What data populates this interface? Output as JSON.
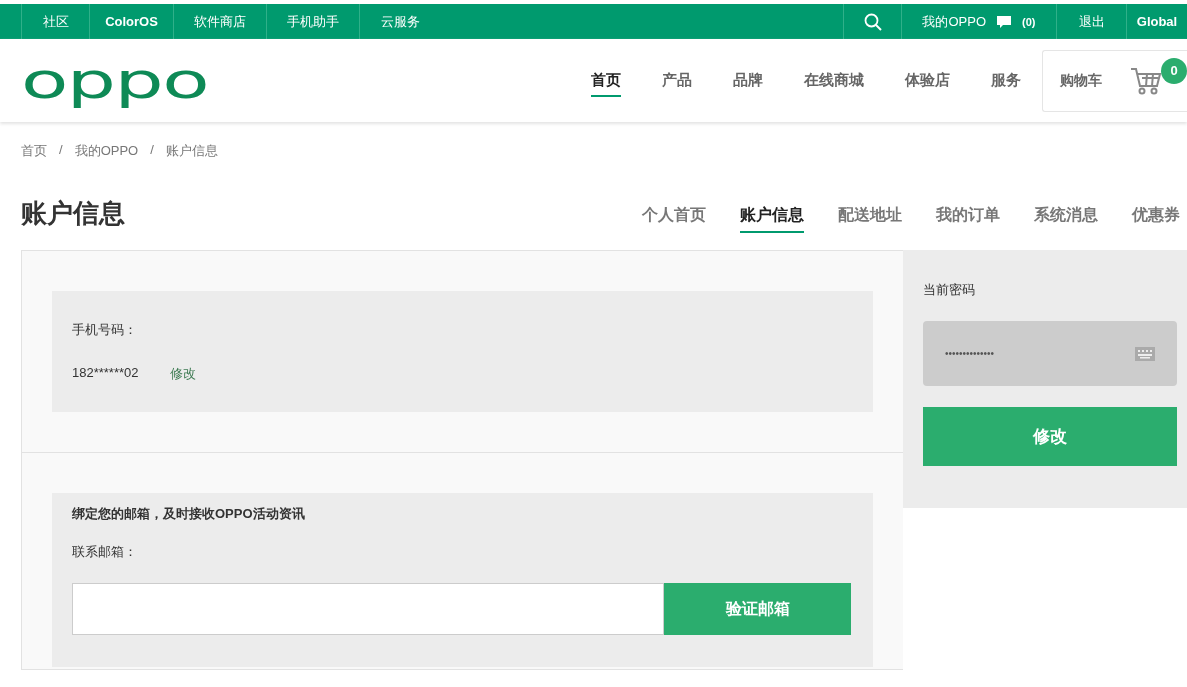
{
  "top_bar": {
    "links": [
      "社区",
      "ColorOS",
      "软件商店",
      "手机助手",
      "云服务"
    ],
    "account": "我的OPPO",
    "messages": "(0)",
    "right_links": [
      "退出",
      "Global"
    ]
  },
  "header": {
    "logo": "oppo",
    "nav": [
      {
        "label": "首页",
        "selected": true
      },
      {
        "label": "产品",
        "selected": false
      },
      {
        "label": "品牌",
        "selected": false
      },
      {
        "label": "在线商城",
        "selected": false
      },
      {
        "label": "体验店",
        "selected": false
      },
      {
        "label": "服务",
        "selected": false
      }
    ],
    "cart": {
      "label": "购物车",
      "count": "0"
    }
  },
  "breadcrumb": {
    "separator": "/",
    "items": [
      "首页",
      "我的OPPO",
      "账户信息"
    ]
  },
  "page_title": "账户信息",
  "account_tabs": [
    {
      "label": "个人首页",
      "selected": false
    },
    {
      "label": "账户信息",
      "selected": true
    },
    {
      "label": "配送地址",
      "selected": false
    },
    {
      "label": "我的订单",
      "selected": false
    },
    {
      "label": "系统消息",
      "selected": false
    },
    {
      "label": "优惠券",
      "selected": false
    }
  ],
  "phone_section": {
    "label": "手机号码：",
    "value": "182******02",
    "edit_link": "修改"
  },
  "email_section": {
    "notice": "绑定您的邮箱，及时接收OPPO活动资讯",
    "label": "联系邮箱：",
    "button": "验证邮箱"
  },
  "password_panel": {
    "label": "当前密码",
    "value": "••••••••••••••",
    "button": "修改"
  }
}
